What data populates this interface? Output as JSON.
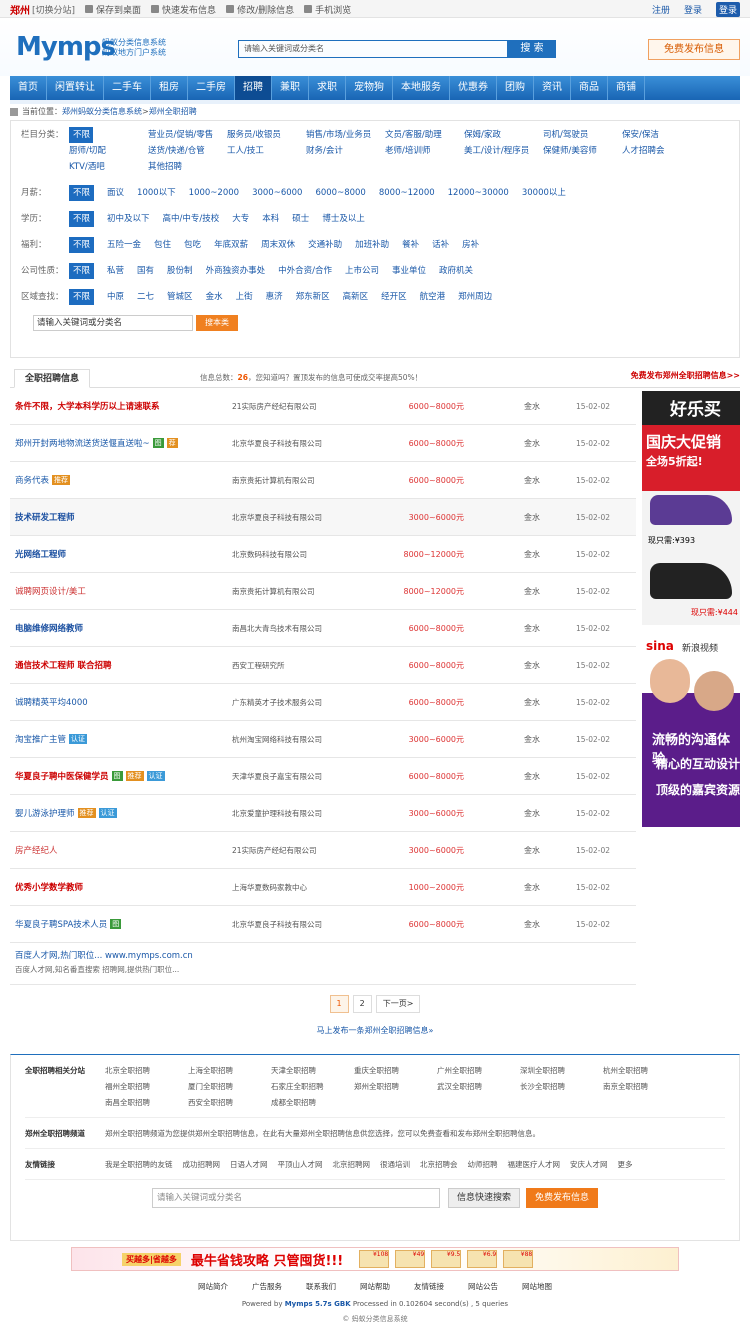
{
  "topbar": {
    "city": "郑州",
    "switch": "[切换分站]",
    "items": [
      "保存到桌面",
      "快速发布信息",
      "修改/删除信息",
      "手机浏览"
    ],
    "register": "注册",
    "login": "登录",
    "login_btn": "登录"
  },
  "header": {
    "logo": "Mymps",
    "logo_sub1": "蚂蚁分类信息系统",
    "logo_sub2": "蚂蚁地方门户系统",
    "search_placeholder": "请输入关键词或分类名",
    "search_btn": "搜 索",
    "post_btn": "免费发布信息"
  },
  "nav": [
    "首页",
    "闲置转让",
    "二手车",
    "租房",
    "二手房",
    "招聘",
    "兼职",
    "求职",
    "宠物狗",
    "本地服务",
    "优惠券",
    "团购",
    "资讯",
    "商品",
    "商铺"
  ],
  "nav_active": "招聘",
  "crumb": {
    "label": "当前位置：",
    "p1": "郑州蚂蚁分类信息系统",
    "sep": " > ",
    "p2": "郑州全职招聘"
  },
  "filters": {
    "category": {
      "label": "栏目分类：",
      "values": [
        "不限",
        "营业员/促销/零售",
        "服务员/收银员",
        "销售/市场/业务员",
        "文员/客服/助理",
        "保姆/家政",
        "司机/驾驶员",
        "保安/保洁",
        "厨师/切配",
        "送货/快递/仓管",
        "工人/技工",
        "财务/会计",
        "老师/培训师",
        "美工/设计/程序员",
        "保健师/美容师",
        "人才招聘会",
        "KTV/酒吧",
        "其他招聘"
      ]
    },
    "salary": {
      "label": "月薪：",
      "values": [
        "不限",
        "面议",
        "1000以下",
        "1000~2000",
        "3000~6000",
        "6000~8000",
        "8000~12000",
        "12000~30000",
        "30000以上"
      ]
    },
    "education": {
      "label": "学历：",
      "values": [
        "不限",
        "初中及以下",
        "高中/中专/技校",
        "大专",
        "本科",
        "硕士",
        "博士及以上"
      ]
    },
    "welfare": {
      "label": "福利：",
      "values": [
        "不限",
        "五险一金",
        "包住",
        "包吃",
        "年底双薪",
        "周末双休",
        "交通补助",
        "加班补助",
        "餐补",
        "话补",
        "房补"
      ]
    },
    "company": {
      "label": "公司性质：",
      "values": [
        "不限",
        "私营",
        "国有",
        "股份制",
        "外商独资办事处",
        "中外合资/合作",
        "上市公司",
        "事业单位",
        "政府机关"
      ]
    },
    "region": {
      "label": "区域查找：",
      "values": [
        "不限",
        "中原",
        "二七",
        "管城区",
        "金水",
        "上街",
        "惠济",
        "郑东新区",
        "高新区",
        "经开区",
        "航空港",
        "郑州周边"
      ]
    },
    "search_value": "请输入关键词或分类名",
    "search_btn": "搜本类"
  },
  "list_header": {
    "tab": "全职招聘信息",
    "info_prefix": "信息总数：",
    "count": "26",
    "info_suffix": "，您知道吗？置顶发布的信息可使成交率提高50%！",
    "post_link": "免费发布郑州全职招聘信息>>"
  },
  "listings": [
    {
      "title": "条件不限，大学本科学历以上请速联系",
      "style": "red",
      "tags": [],
      "company": "21实际房产经纪有限公司",
      "salary": "6000~8000元",
      "area": "金水",
      "date": "15-02-02"
    },
    {
      "title": "郑州开封两地物流送货送偃直送啦~",
      "style": "norm",
      "tags": [
        {
          "t": "图",
          "c": "g"
        },
        {
          "t": "荐",
          "c": "o"
        }
      ],
      "company": "北京华夏良子科技有限公司",
      "salary": "6000~8000元",
      "area": "金水",
      "date": "15-02-02"
    },
    {
      "title": "商务代表",
      "style": "norm",
      "tags": [
        {
          "t": "推荐",
          "c": "o"
        }
      ],
      "company": "南京贵拓计算机有限公司",
      "salary": "6000~8000元",
      "area": "金水",
      "date": "15-02-02"
    },
    {
      "title": "技术研发工程师",
      "style": "blue",
      "tags": [],
      "company": "北京华夏良子科技有限公司",
      "salary": "3000~6000元",
      "area": "金水",
      "date": "15-02-02"
    },
    {
      "title": "光网络工程师",
      "style": "blue",
      "tags": [],
      "company": "北京数码科技有限公司",
      "salary": "8000~12000元",
      "area": "金水",
      "date": "15-02-02"
    },
    {
      "title": "诚聘网页设计/美工",
      "style": "dred",
      "tags": [],
      "company": "南京贵拓计算机有限公司",
      "salary": "8000~12000元",
      "area": "金水",
      "date": "15-02-02"
    },
    {
      "title": "电脑维修网络教师",
      "style": "blue",
      "tags": [],
      "company": "南昌北大青鸟技术有限公司",
      "salary": "6000~8000元",
      "area": "金水",
      "date": "15-02-02"
    },
    {
      "title": "通信技术工程师 联合招聘",
      "style": "red",
      "tags": [],
      "company": "西安工程研究所",
      "salary": "6000~8000元",
      "area": "金水",
      "date": "15-02-02"
    },
    {
      "title": "诚聘精英平均4000",
      "style": "norm",
      "tags": [],
      "company": "广东精英才子技术服务公司",
      "salary": "6000~8000元",
      "area": "金水",
      "date": "15-02-02"
    },
    {
      "title": "淘宝推广主管",
      "style": "norm",
      "tags": [
        {
          "t": "认证",
          "c": "b"
        }
      ],
      "company": "杭州淘宝网络科技有限公司",
      "salary": "3000~6000元",
      "area": "金水",
      "date": "15-02-02"
    },
    {
      "title": "华夏良子聘中医保健学员",
      "style": "red",
      "tags": [
        {
          "t": "图",
          "c": "g"
        },
        {
          "t": "推荐",
          "c": "o"
        },
        {
          "t": "认证",
          "c": "b"
        }
      ],
      "company": "天津华夏良子嘉宝有限公司",
      "salary": "6000~8000元",
      "area": "金水",
      "date": "15-02-02"
    },
    {
      "title": "婴儿游泳护理师",
      "style": "norm",
      "tags": [
        {
          "t": "推荐",
          "c": "o"
        },
        {
          "t": "认证",
          "c": "b"
        }
      ],
      "company": "北京爱童护理科技有限公司",
      "salary": "3000~6000元",
      "area": "金水",
      "date": "15-02-02"
    },
    {
      "title": "房产经纪人",
      "style": "dred",
      "tags": [],
      "company": "21实际房产经纪有限公司",
      "salary": "3000~6000元",
      "area": "金水",
      "date": "15-02-02"
    },
    {
      "title": "优秀小学数学教师",
      "style": "red",
      "tags": [],
      "company": "上海华夏数码家教中心",
      "salary": "1000~2000元",
      "area": "金水",
      "date": "15-02-02"
    },
    {
      "title": "华夏良子聘SPA技术人员",
      "style": "norm",
      "tags": [
        {
          "t": "图",
          "c": "g"
        }
      ],
      "company": "北京华夏良子科技有限公司",
      "salary": "6000~8000元",
      "area": "金水",
      "date": "15-02-02"
    }
  ],
  "ad_row": {
    "title": "百度人才网,热门职位... www.mymps.com.cn",
    "desc": "百度人才网,知名番直搜索 招聘网,提供热门职位..."
  },
  "side_ads": {
    "a1_l1": "好乐买",
    "a1_l2": "国庆大促销",
    "a1_l3": "全场5折起!",
    "a1_p1": "现只需:¥393",
    "a1_p2": "现只需:¥444",
    "a2_sina": "sina",
    "a2_sina2": "新浪视频",
    "a2_k1": "流畅的沟通体验",
    "a2_k2": "精心的互动设计",
    "a2_k3": "顶级的嘉宾资源"
  },
  "pager": {
    "p1": "1",
    "p2": "2",
    "next": "下一页>"
  },
  "pub_tip": "马上发布一条郑州全职招聘信息»",
  "footer": {
    "related_label": "全职招聘相关分站",
    "related": [
      "北京全职招聘",
      "上海全职招聘",
      "天津全职招聘",
      "重庆全职招聘",
      "广州全职招聘",
      "深圳全职招聘",
      "杭州全职招聘",
      "福州全职招聘",
      "厦门全职招聘",
      "石家庄全职招聘",
      "郑州全职招聘",
      "武汉全职招聘",
      "长沙全职招聘",
      "南京全职招聘",
      "南昌全职招聘",
      "西安全职招聘",
      "成都全职招聘"
    ],
    "channel_label": "郑州全职招聘频道",
    "channel_text": "郑州全职招聘频道为您提供郑州全职招聘信息，在此有大量郑州全职招聘信息供您选择，您可以免费查看和发布郑州全职招聘信息。",
    "links_label": "友情链接",
    "links": [
      "我是全职招聘的友链",
      "成功招聘网",
      "日语人才网",
      "平顶山人才网",
      "北京招聘网",
      "很通培训",
      "北京招聘会",
      "幼师招聘",
      "福建医疗人才网",
      "安庆人才网",
      "更多"
    ],
    "search_placeholder": "请输入关键词或分类名",
    "search_btn": "信息快速搜索",
    "post_btn": "免费发布信息"
  },
  "banner": {
    "b1": "买越多|省越多",
    "b2": "最牛省钱攻略 只管囤货!!!",
    "prices": [
      "¥108",
      "¥49",
      "¥9.5",
      "¥6.9",
      "¥88"
    ]
  },
  "foot_links": [
    "网站简介",
    "广告服务",
    "联系我们",
    "网站帮助",
    "友情链接",
    "网站公告",
    "网站地图"
  ],
  "powered": {
    "pre": "Powered by ",
    "brand": "Mymps 5.7s GBK",
    "post": " Processed in 0.102604 second(s) , 5 queries"
  },
  "copy": "© 蚂蚁分类信息系统"
}
